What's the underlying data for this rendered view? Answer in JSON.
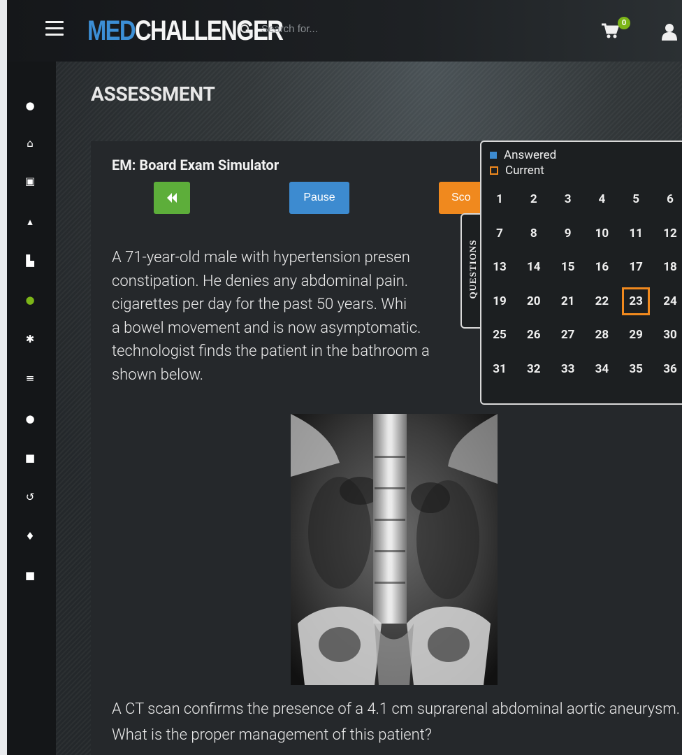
{
  "header": {
    "logo_part1": "MED",
    "logo_part2": "CHALLENGER",
    "search_placeholder": "Search for...",
    "cart_count": "0"
  },
  "sidebar": {
    "items": [
      {
        "name": "play-icon",
        "glyph": "●"
      },
      {
        "name": "home-icon",
        "glyph": "⌂"
      },
      {
        "name": "calendar-icon",
        "glyph": "▣"
      },
      {
        "name": "graduation-cap-icon",
        "glyph": "▴"
      },
      {
        "name": "cart-icon",
        "glyph": "▙"
      },
      {
        "name": "group-icon",
        "glyph": "●"
      },
      {
        "name": "tools-icon",
        "glyph": "✱"
      },
      {
        "name": "list-icon",
        "glyph": "≡"
      },
      {
        "name": "badge-icon",
        "glyph": "●"
      },
      {
        "name": "book-icon",
        "glyph": "■"
      },
      {
        "name": "history-icon",
        "glyph": "↺"
      },
      {
        "name": "trophy-icon",
        "glyph": "♦"
      },
      {
        "name": "briefcase-icon",
        "glyph": "■"
      }
    ],
    "active_color": "#7cb518"
  },
  "page": {
    "title": "ASSESSMENT"
  },
  "exam": {
    "title": "EM: Board Exam Simulator",
    "back_label": "«",
    "pause_label": "Pause",
    "score_label": "Sco",
    "question_part1": "A 71-year-old male with hypertension presen constipation. He denies any abdominal pain. cigarettes per day for the past 50 years. Whi a bowel movement and is now asymptomatic. technologist finds the patient in the bathroom a shown below.",
    "question_lines": [
      "A 71-year-old male with hypertension presen",
      "constipation. He denies any abdominal pain.",
      "cigarettes per day for the past 50 years. Whi",
      "a bowel movement and is now asymptomatic.",
      "technologist finds the patient in the bathroom a",
      "shown below."
    ],
    "question_part2": "A CT scan confirms the presence of a 4.1 cm suprarenal abdominal aortic aneurysm. What is the proper management of this patient?"
  },
  "questions_panel": {
    "tab_label": "QUESTIONS",
    "legend_answered": "Answered",
    "legend_current": "Current",
    "numbers": [
      "1",
      "2",
      "3",
      "4",
      "5",
      "6",
      "7",
      "8",
      "9",
      "10",
      "11",
      "12",
      "13",
      "14",
      "15",
      "16",
      "17",
      "18",
      "19",
      "20",
      "21",
      "22",
      "23",
      "24",
      "25",
      "26",
      "27",
      "28",
      "29",
      "30",
      "31",
      "32",
      "33",
      "34",
      "35",
      "36"
    ],
    "current": "23",
    "colors": {
      "answered": "#3d8bd0",
      "current": "#f0891e"
    }
  }
}
